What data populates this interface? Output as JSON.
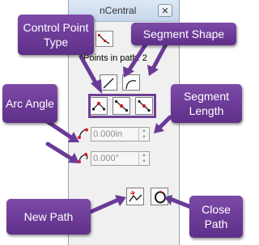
{
  "window": {
    "title": "nCentral",
    "close_glyph": "✕"
  },
  "panel": {
    "points_label": "Points in path: 2"
  },
  "fields": {
    "length_value": "0.000in",
    "angle_value": "0.000°"
  },
  "callouts": {
    "control_point_type": "Control Point Type",
    "segment_shape": "Segment Shape",
    "arc_angle": "Arc Angle",
    "segment_length": "Segment Length",
    "new_path": "New Path",
    "close_path": "Close Path"
  },
  "colors": {
    "callout_purple": "#6a3a98",
    "outline_purple": "#6e3f96",
    "icon_red": "#d42020",
    "icon_dark": "#1a1a1a"
  },
  "icons": {
    "segment_line": "straight-line-icon",
    "segment_curve": "curve-icon",
    "new_path": "new-path-icon",
    "close_path": "close-path-icon"
  }
}
